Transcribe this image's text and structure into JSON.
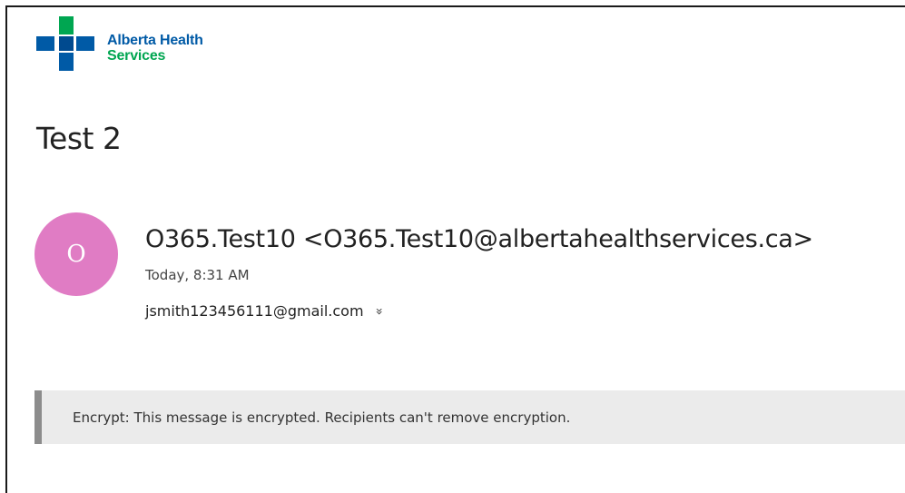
{
  "brand": {
    "line1": "Alberta Health",
    "line2": "Services",
    "colors": {
      "blue": "#005aa6",
      "green": "#00a651",
      "dark_blue": "#004a8f"
    }
  },
  "message": {
    "subject": "Test 2",
    "avatar_initial": "O",
    "avatar_color": "#e07cc4",
    "sender": "O365.Test10 <O365.Test10@albertahealthservices.ca>",
    "date": "Today, 8:31 AM",
    "recipient": "jsmith123456111@gmail.com",
    "expand_icon": "double-chevron-down-icon"
  },
  "banner": {
    "text": "Encrypt: This message is encrypted. Recipients can't remove encryption."
  }
}
